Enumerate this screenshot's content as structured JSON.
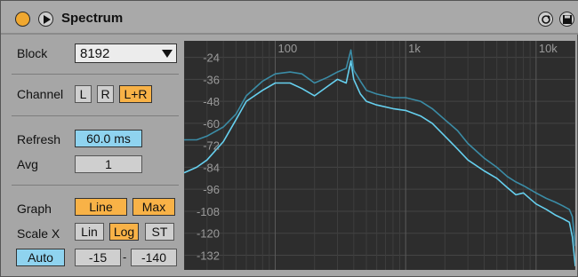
{
  "title": "Spectrum",
  "icons": {
    "power": "power-icon",
    "play": "play-icon",
    "hot_swap": "hot-swap-icon",
    "save": "save-icon"
  },
  "controls": {
    "block_label": "Block",
    "block_value": "8192",
    "channel_label": "Channel",
    "channel_buttons": [
      "L",
      "R",
      "L+R"
    ],
    "channel_active": "L+R",
    "refresh_label": "Refresh",
    "refresh_value": "60.0 ms",
    "avg_label": "Avg",
    "avg_value": "1",
    "graph_label": "Graph",
    "graph_buttons": [
      "Line",
      "Max"
    ],
    "scale_x_label": "Scale X",
    "scale_x_buttons": [
      "Lin",
      "Log",
      "ST"
    ],
    "scale_x_active": "Log",
    "auto_label": "Auto",
    "range_min": "-15",
    "range_max": "-140",
    "range_separator": "-"
  },
  "colors": {
    "accent_orange": "#f8b247",
    "accent_blue": "#8fd3ef",
    "graph_bg": "#2d2d2d",
    "spectrum_line": "#66d0ef",
    "spectrum_max": "#3b8ca6"
  },
  "chart_data": {
    "type": "line",
    "x_scale": "log",
    "x_tick_labels": [
      "100",
      "1k",
      "10k"
    ],
    "x_ticks_hz": [
      100,
      1000,
      10000
    ],
    "y_tick_labels": [
      "-24",
      "-36",
      "-48",
      "-60",
      "-72",
      "-84",
      "-96",
      "-108",
      "-120",
      "-132"
    ],
    "ylim": [
      -140,
      -15
    ],
    "xlim_hz": [
      20,
      20000
    ],
    "grid": true,
    "series": [
      {
        "role": "line",
        "color": "#66d0ef",
        "x_hz": [
          20,
          25,
          30,
          40,
          50,
          60,
          80,
          100,
          130,
          160,
          200,
          250,
          300,
          350,
          380,
          400,
          450,
          500,
          600,
          800,
          1000,
          1300,
          1600,
          2000,
          2500,
          3000,
          4000,
          5000,
          6000,
          7000,
          8000,
          10000,
          12000,
          14000,
          16000,
          18000,
          19000,
          20000
        ],
        "y_db": [
          -87,
          -84,
          -80,
          -70,
          -58,
          -48,
          -42,
          -38,
          -38,
          -41,
          -45,
          -40,
          -36,
          -38,
          -26,
          -36,
          -44,
          -48,
          -50,
          -52,
          -53,
          -56,
          -60,
          -67,
          -74,
          -80,
          -86,
          -90,
          -95,
          -99,
          -98,
          -104,
          -107,
          -110,
          -112,
          -114,
          -122,
          -138
        ]
      },
      {
        "role": "max",
        "color": "#3b8ca6",
        "x_hz": [
          20,
          25,
          30,
          40,
          50,
          60,
          80,
          100,
          130,
          160,
          200,
          250,
          300,
          350,
          380,
          400,
          450,
          500,
          600,
          800,
          1000,
          1300,
          1600,
          2000,
          2500,
          3000,
          4000,
          5000,
          6000,
          7000,
          8000,
          10000,
          12000,
          14000,
          16000,
          18000,
          19000,
          20000
        ],
        "y_db": [
          -69,
          -69,
          -67,
          -62,
          -55,
          -45,
          -37,
          -33,
          -32,
          -33,
          -38,
          -35,
          -32,
          -30,
          -20,
          -31,
          -37,
          -42,
          -44,
          -46,
          -46,
          -48,
          -52,
          -58,
          -64,
          -71,
          -79,
          -84,
          -89,
          -92,
          -94,
          -98,
          -101,
          -103,
          -105,
          -107,
          -111,
          -127
        ]
      }
    ]
  }
}
